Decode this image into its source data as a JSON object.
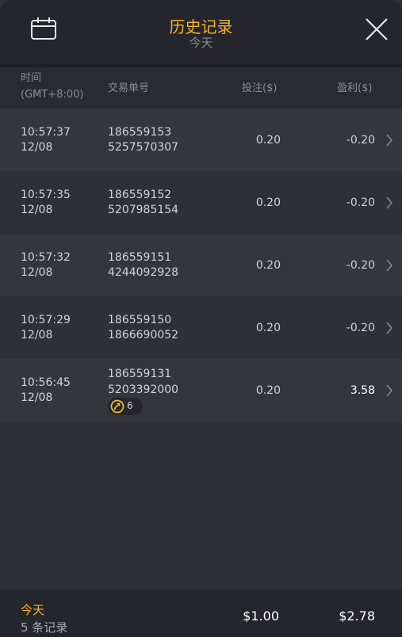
{
  "header": {
    "title": "历史记录",
    "subtitle": "今天"
  },
  "columns": {
    "time_line1": "时间",
    "time_line2": "(GMT+8:00)",
    "order": "交易单号",
    "stake": "投注($)",
    "profit": "盈利($)"
  },
  "rows": [
    {
      "time": "10:57:37",
      "date": "12/08",
      "order1": "186559153",
      "order2": "5257570307",
      "stake": "0.20",
      "profit": "-0.20"
    },
    {
      "time": "10:57:35",
      "date": "12/08",
      "order1": "186559152",
      "order2": "5207985154",
      "stake": "0.20",
      "profit": "-0.20"
    },
    {
      "time": "10:57:32",
      "date": "12/08",
      "order1": "186559151",
      "order2": "4244092928",
      "stake": "0.20",
      "profit": "-0.20"
    },
    {
      "time": "10:57:29",
      "date": "12/08",
      "order1": "186559150",
      "order2": "1866690052",
      "stake": "0.20",
      "profit": "-0.20"
    },
    {
      "time": "10:56:45",
      "date": "12/08",
      "order1": "186559131",
      "order2": "5203392000",
      "stake": "0.20",
      "profit": "3.58",
      "badge_count": "6"
    }
  ],
  "footer": {
    "label": "今天",
    "count": "5 条记录",
    "total_stake": "$1.00",
    "total_profit": "$2.78"
  },
  "colors": {
    "accent": "#f1b52a",
    "header_bg": "#25252d",
    "body_bg": "#2f2f39"
  },
  "icons": [
    "calendar-icon",
    "close-icon",
    "chevron-right-icon",
    "free-spins-icon"
  ]
}
